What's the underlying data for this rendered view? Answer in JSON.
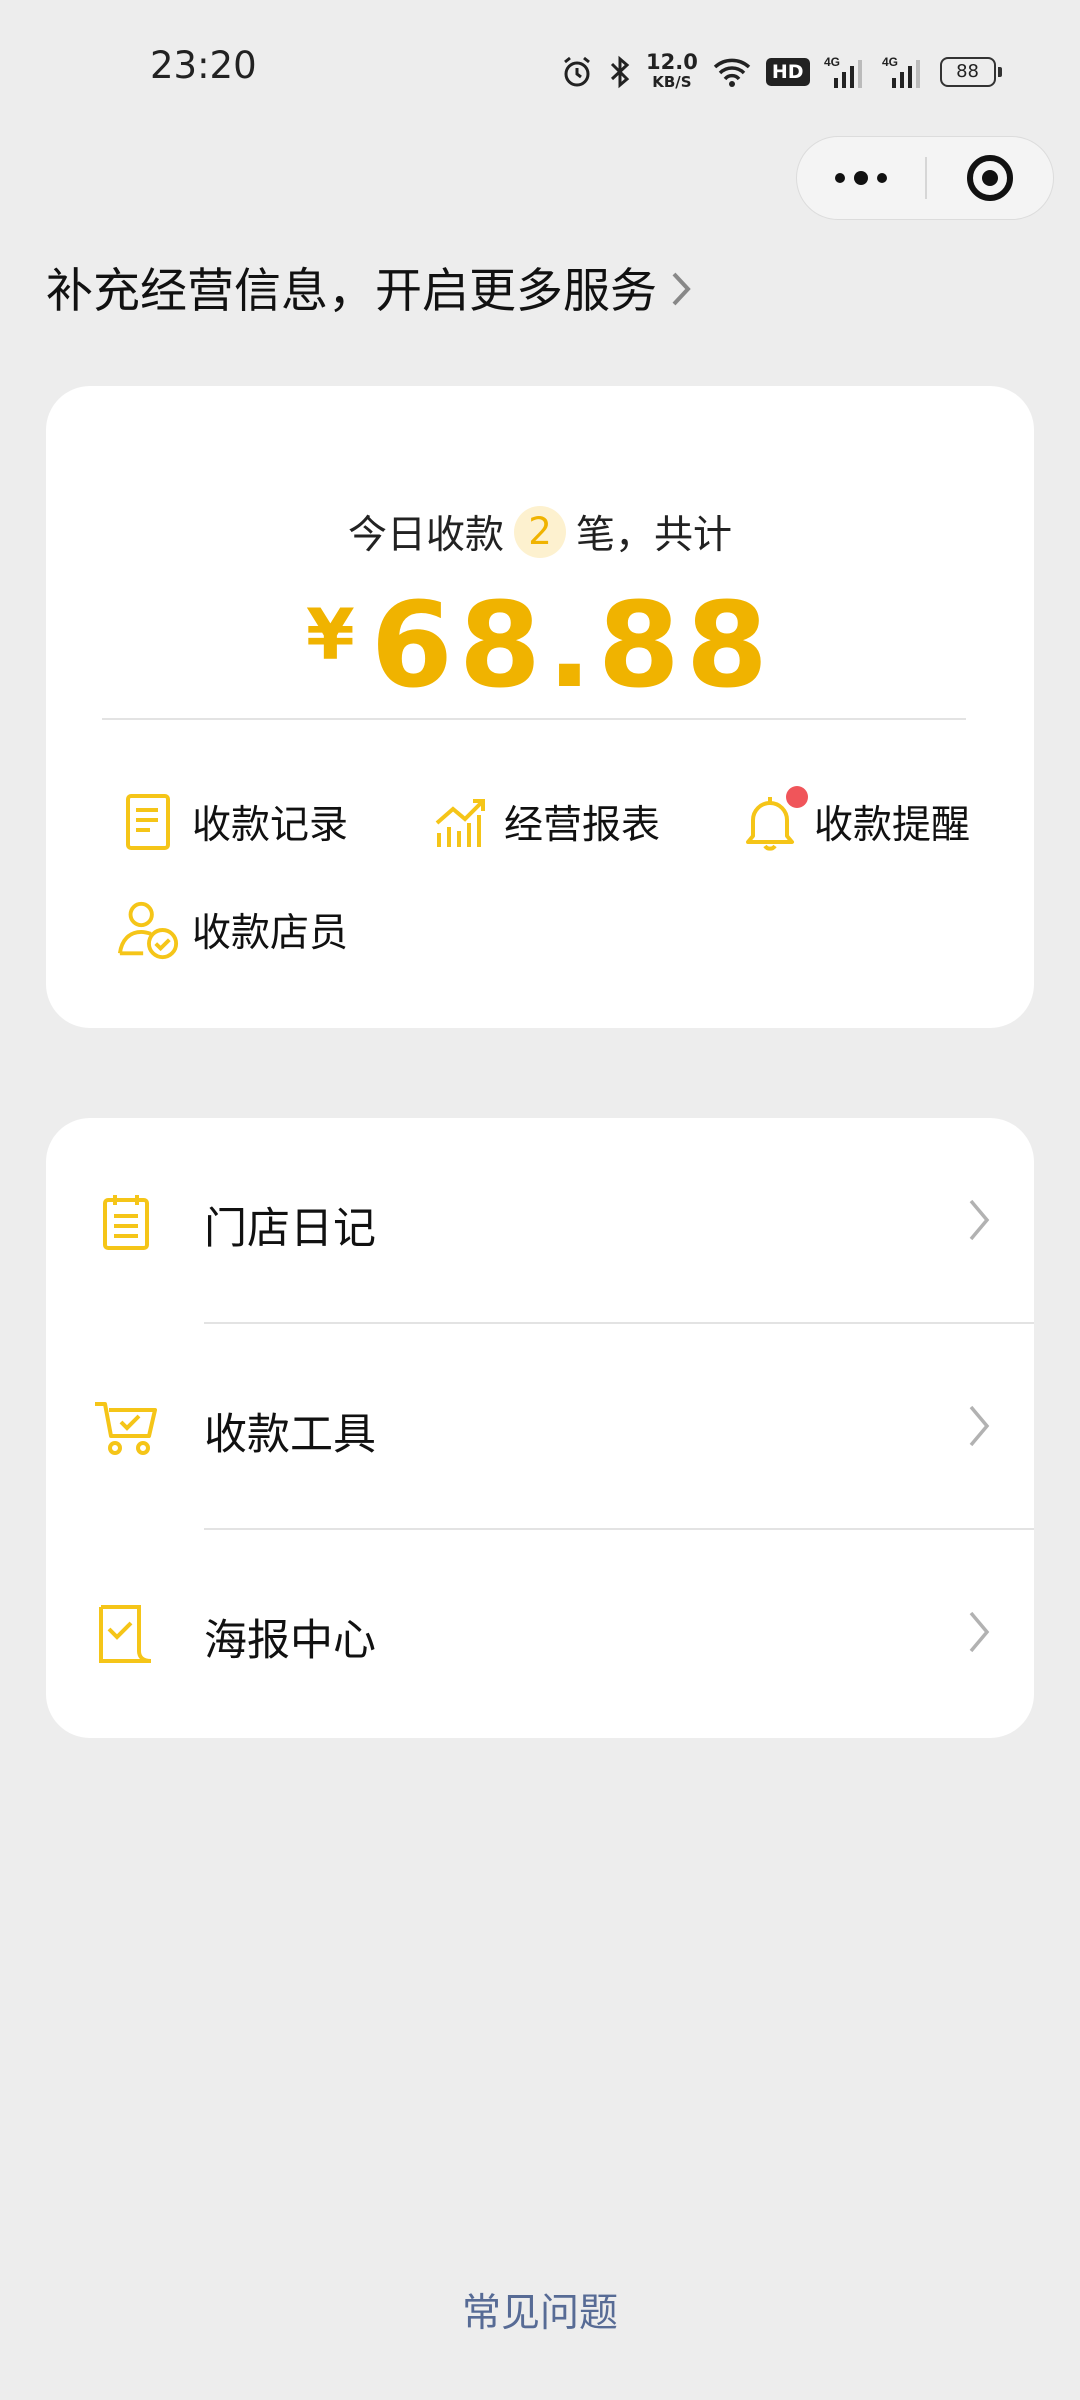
{
  "status_bar": {
    "time": "23:20",
    "net_speed_value": "12.0",
    "net_speed_unit": "KB/S",
    "hd_label": "HD",
    "signal_1_label": "4G",
    "signal_2_label": "4G",
    "battery": "88",
    "icons": [
      "alarm-icon",
      "bluetooth-icon",
      "wifi-icon",
      "hd-icon",
      "signal-icon",
      "signal-icon",
      "battery-icon"
    ]
  },
  "capsule": {
    "more_icon": "more-dots-icon",
    "close_icon": "target-icon"
  },
  "header": {
    "title": "补充经营信息，开启更多服务"
  },
  "summary": {
    "prefix": "今日收款",
    "count": "2",
    "suffix": "笔，共计",
    "currency": "¥",
    "amount": "68.88"
  },
  "quick_actions": [
    {
      "label": "收款记录",
      "icon": "document-icon"
    },
    {
      "label": "经营报表",
      "icon": "chart-icon"
    },
    {
      "label": "收款提醒",
      "icon": "bell-icon",
      "has_dot": true
    },
    {
      "label": "收款店员",
      "icon": "staff-icon"
    }
  ],
  "menu": [
    {
      "label": "门店日记",
      "icon": "notepad-icon"
    },
    {
      "label": "收款工具",
      "icon": "cart-icon"
    },
    {
      "label": "海报中心",
      "icon": "poster-icon"
    }
  ],
  "footer": {
    "faq": "常见问题"
  },
  "colors": {
    "accent": "#f0b300",
    "link": "#576b95",
    "badge_bg": "#fdf1cf",
    "dot": "#f0555a",
    "background": "#ededed"
  }
}
